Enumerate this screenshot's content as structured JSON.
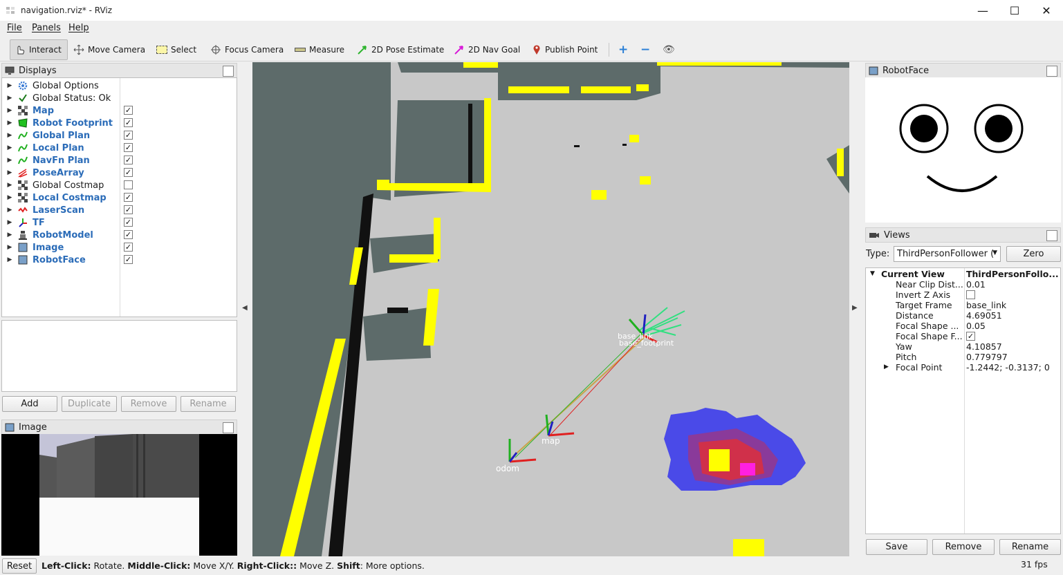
{
  "window": {
    "title": "navigation.rviz* - RViz",
    "min": "—",
    "max": "☐",
    "close": "✕"
  },
  "menu": [
    "File",
    "Panels",
    "Help"
  ],
  "toolbar": {
    "interact": "Interact",
    "move_camera": "Move Camera",
    "select": "Select",
    "focus_camera": "Focus Camera",
    "measure": "Measure",
    "pose_estimate": "2D Pose Estimate",
    "nav_goal": "2D Nav Goal",
    "publish_point": "Publish Point"
  },
  "displays": {
    "title": "Displays",
    "items": [
      {
        "label": "Global Options",
        "icon": "gear-icon",
        "checked": null
      },
      {
        "label": "Global Status: Ok",
        "icon": "checkmark-icon",
        "checked": null
      },
      {
        "label": "Map",
        "icon": "map-icon",
        "checked": true
      },
      {
        "label": "Robot Footprint",
        "icon": "polygon-icon",
        "checked": true
      },
      {
        "label": "Global Plan",
        "icon": "path-icon",
        "checked": true
      },
      {
        "label": "Local Plan",
        "icon": "path-icon",
        "checked": true
      },
      {
        "label": "NavFn Plan",
        "icon": "path-icon",
        "checked": true
      },
      {
        "label": "PoseArray",
        "icon": "posearray-icon",
        "checked": true
      },
      {
        "label": "Global Costmap",
        "icon": "map-icon",
        "checked": false
      },
      {
        "label": "Local Costmap",
        "icon": "map-icon",
        "checked": true
      },
      {
        "label": "LaserScan",
        "icon": "laserscan-icon",
        "checked": true
      },
      {
        "label": "TF",
        "icon": "tf-icon",
        "checked": true
      },
      {
        "label": "RobotModel",
        "icon": "robot-icon",
        "checked": true
      },
      {
        "label": "Image",
        "icon": "image-icon",
        "checked": true
      },
      {
        "label": "RobotFace",
        "icon": "image-icon",
        "checked": true
      }
    ],
    "buttons": {
      "add": "Add",
      "duplicate": "Duplicate",
      "remove": "Remove",
      "rename": "Rename"
    }
  },
  "image_panel": {
    "title": "Image"
  },
  "robotface_panel": {
    "title": "RobotFace"
  },
  "views": {
    "title": "Views",
    "type_label": "Type:",
    "type_value": "ThirdPersonFollower (",
    "zero": "Zero",
    "rows": [
      {
        "key": "Current View",
        "value": "ThirdPersonFollo..."
      },
      {
        "key": "Near Clip Dist...",
        "value": "0.01"
      },
      {
        "key": "Invert Z Axis",
        "value": ""
      },
      {
        "key": "Target Frame",
        "value": "base_link"
      },
      {
        "key": "Distance",
        "value": "4.69051"
      },
      {
        "key": "Focal Shape ...",
        "value": "0.05"
      },
      {
        "key": "Focal Shape F...",
        "value": ""
      },
      {
        "key": "Yaw",
        "value": "4.10857"
      },
      {
        "key": "Pitch",
        "value": "0.779797"
      },
      {
        "key": "Focal Point",
        "value": "-1.2442; -0.3137; 0"
      }
    ],
    "buttons": {
      "save": "Save",
      "remove": "Remove",
      "rename": "Rename"
    }
  },
  "viewport": {
    "labels": {
      "odom": "odom",
      "map": "map",
      "base_link": "base_link",
      "base_footprint": "base_footprint"
    }
  },
  "status": {
    "reset": "Reset",
    "hint_bold_1": "Left-Click:",
    "hint_1": " Rotate. ",
    "hint_bold_2": "Middle-Click:",
    "hint_2": " Move X/Y. ",
    "hint_bold_3": "Right-Click::",
    "hint_3": " Move Z. ",
    "hint_bold_4": "Shift",
    "hint_4": ": More options.",
    "fps": "31 fps"
  },
  "colors": {
    "accent": "#2b6cb8",
    "obstacle": "#ffff00",
    "floor": "#c8c8c8",
    "wall": "#5d6b6a"
  }
}
